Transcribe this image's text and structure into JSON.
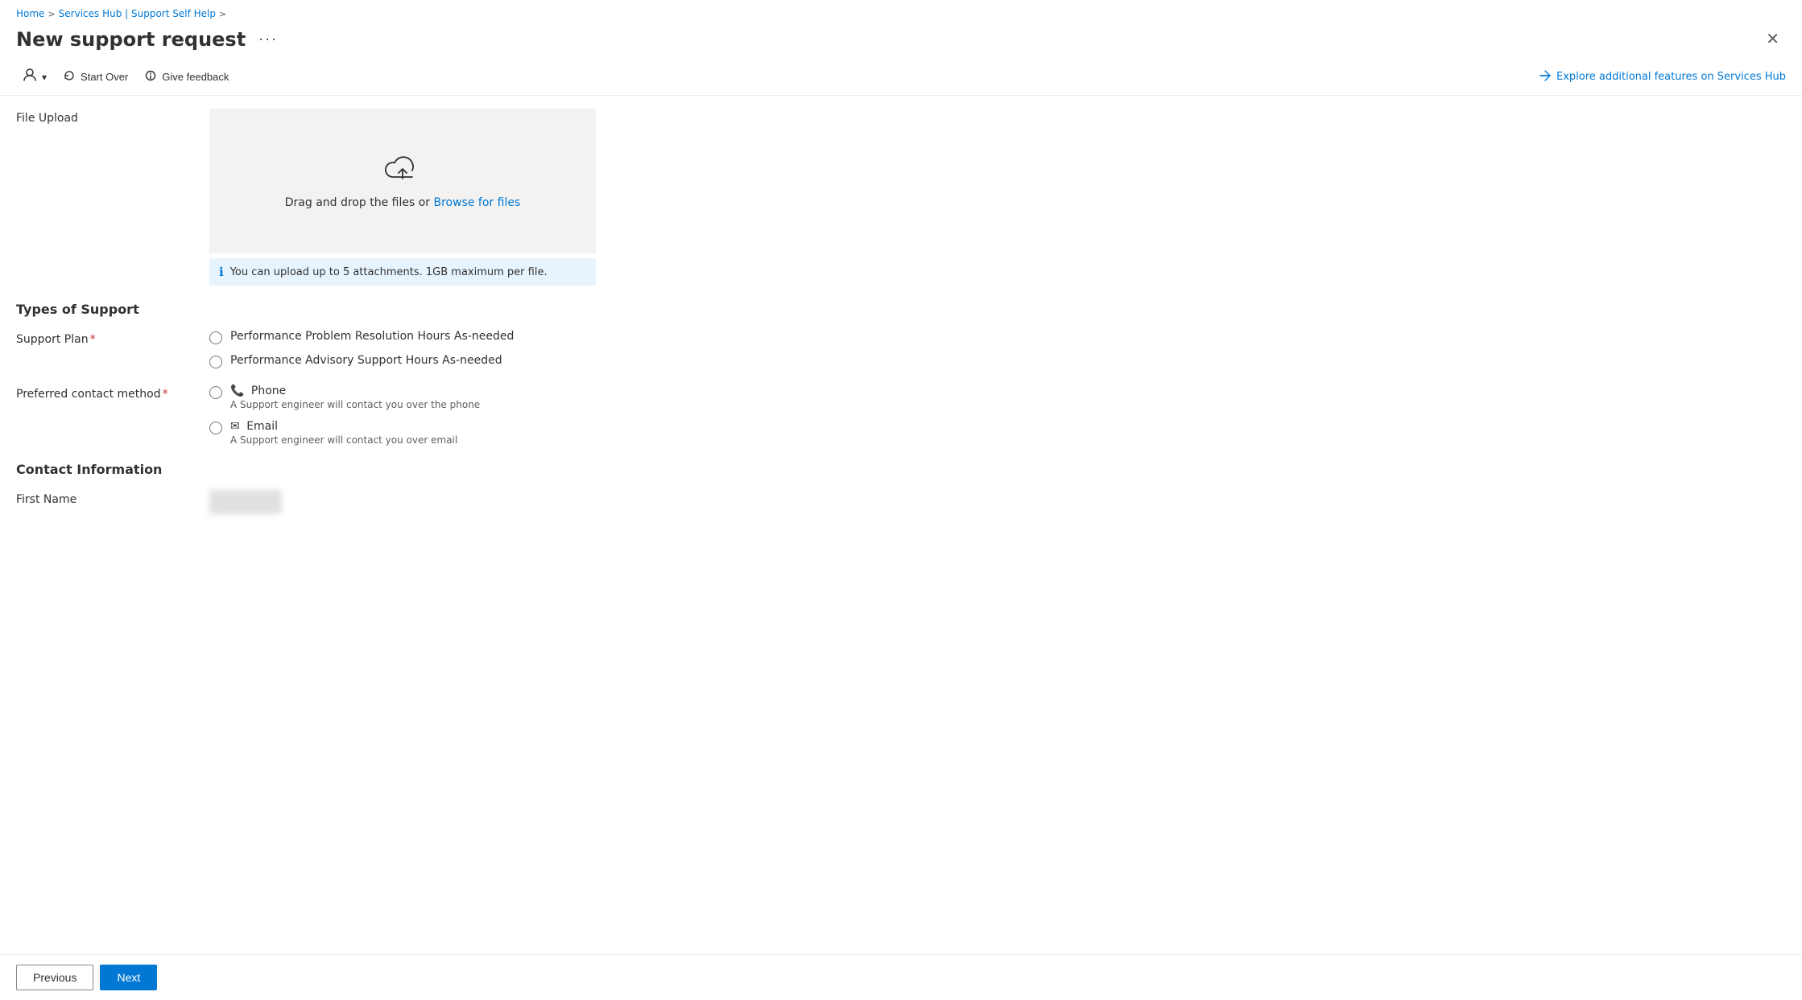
{
  "breadcrumb": {
    "home": "Home",
    "sep1": ">",
    "services_hub": "Services Hub | Support Self Help",
    "sep2": ">"
  },
  "page": {
    "title": "New support request",
    "more_label": "···"
  },
  "toolbar": {
    "user_icon": "👤",
    "dropdown_icon": "▾",
    "start_over_label": "Start Over",
    "give_feedback_label": "Give feedback",
    "explore_label": "Explore additional features on Services Hub"
  },
  "file_upload": {
    "label": "File Upload",
    "drag_text": "Drag and drop the files or ",
    "browse_text": "Browse for files",
    "info_text": "You can upload up to 5 attachments. 1GB maximum per file."
  },
  "types_of_support": {
    "section_label": "Types of Support",
    "support_plan_label": "Support Plan",
    "required": "*",
    "options": [
      {
        "value": "perf_problem",
        "label": "Performance Problem Resolution Hours As-needed"
      },
      {
        "value": "perf_advisory",
        "label": "Performance Advisory Support Hours As-needed"
      }
    ]
  },
  "contact_method": {
    "label": "Preferred contact method",
    "required": "*",
    "options": [
      {
        "value": "phone",
        "icon": "📞",
        "label": "Phone",
        "sub": "A Support engineer will contact you over the phone"
      },
      {
        "value": "email",
        "icon": "✉",
        "label": "Email",
        "sub": "A Support engineer will contact you over email"
      }
    ]
  },
  "contact_info": {
    "section_label": "Contact Information",
    "first_name_label": "First Name"
  },
  "navigation": {
    "previous_label": "Previous",
    "next_label": "Next"
  }
}
